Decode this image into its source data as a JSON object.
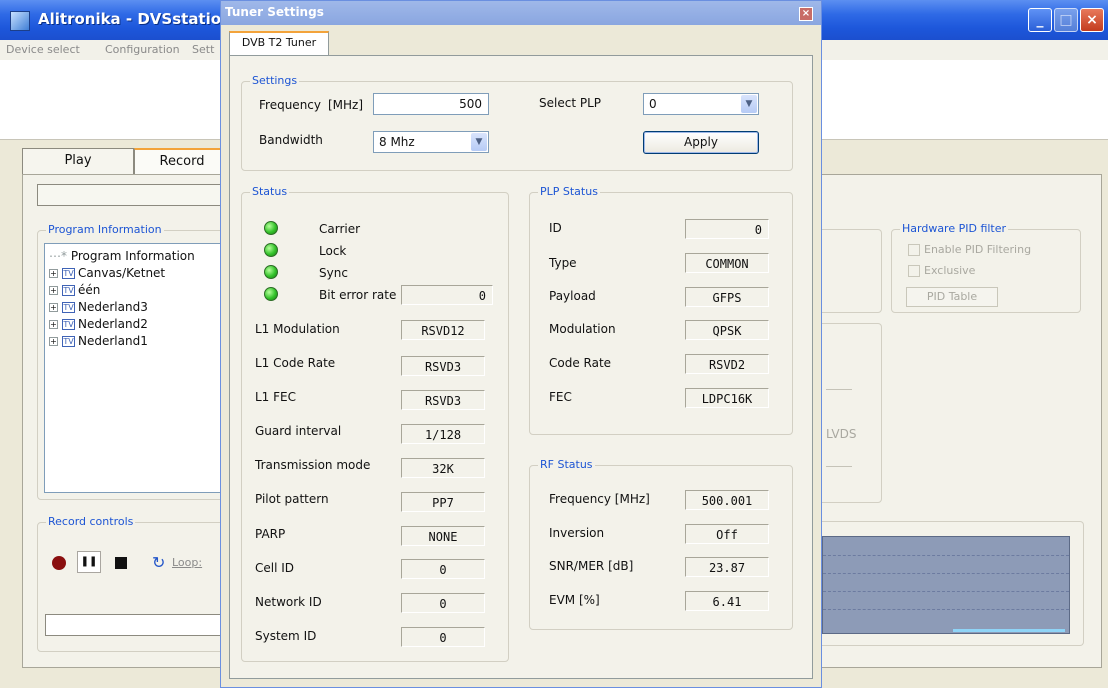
{
  "main_window": {
    "title": "Alitronika - DVSstation III",
    "menu": [
      "Device select",
      "Configuration",
      "Sett"
    ],
    "tabs": [
      "Play",
      "Record"
    ],
    "program_information": {
      "title": "Program Information",
      "tree_root": "Program Information",
      "channels": [
        "Canvas/Ketnet",
        "één",
        "Nederland3",
        "Nederland2",
        "Nederland1"
      ]
    },
    "record_controls": {
      "title": "Record controls",
      "loop_label": "Loop:"
    },
    "hardware_pid_filter": {
      "title": "Hardware PID filter",
      "enable_label": "Enable PID Filtering",
      "exclusive_label": "Exclusive",
      "pid_table_button": "PID Table"
    },
    "lvds_label": "LVDS"
  },
  "dialog": {
    "title": "Tuner Settings",
    "close_glyph": "×",
    "tab": "DVB T2 Tuner",
    "settings": {
      "title": "Settings",
      "frequency_label": "Frequency",
      "frequency_unit": "[MHz]",
      "frequency_value": "500",
      "select_plp_label": "Select PLP",
      "plp_value": "0",
      "bandwidth_label": "Bandwidth",
      "bandwidth_value": "8 Mhz",
      "apply_button": "Apply"
    },
    "status": {
      "title": "Status",
      "leds": [
        "Carrier",
        "Lock",
        "Sync",
        "Bit error rate"
      ],
      "bit_error_rate": "0",
      "rows": [
        {
          "label": "L1 Modulation",
          "value": "RSVD12"
        },
        {
          "label": "L1 Code Rate",
          "value": "RSVD3"
        },
        {
          "label": "L1 FEC",
          "value": "RSVD3"
        },
        {
          "label": "Guard interval",
          "value": "1/128"
        },
        {
          "label": "Transmission mode",
          "value": "32K"
        },
        {
          "label": "Pilot pattern",
          "value": "PP7"
        },
        {
          "label": "PARP",
          "value": "NONE"
        },
        {
          "label": "Cell ID",
          "value": "0"
        },
        {
          "label": "Network ID",
          "value": "0"
        },
        {
          "label": "System ID",
          "value": "0"
        }
      ]
    },
    "plp_status": {
      "title": "PLP Status",
      "rows": [
        {
          "label": "ID",
          "value": "0"
        },
        {
          "label": "Type",
          "value": "COMMON"
        },
        {
          "label": "Payload",
          "value": "GFPS"
        },
        {
          "label": "Modulation",
          "value": "QPSK"
        },
        {
          "label": "Code Rate",
          "value": "RSVD2"
        },
        {
          "label": "FEC",
          "value": "LDPC16K"
        }
      ]
    },
    "rf_status": {
      "title": "RF Status",
      "rows": [
        {
          "label": "Frequency [MHz]",
          "value": "500.001"
        },
        {
          "label": "Inversion",
          "value": "Off"
        },
        {
          "label": "SNR/MER [dB]",
          "value": "23.87"
        },
        {
          "label": "EVM [%]",
          "value": "6.41"
        }
      ]
    }
  }
}
